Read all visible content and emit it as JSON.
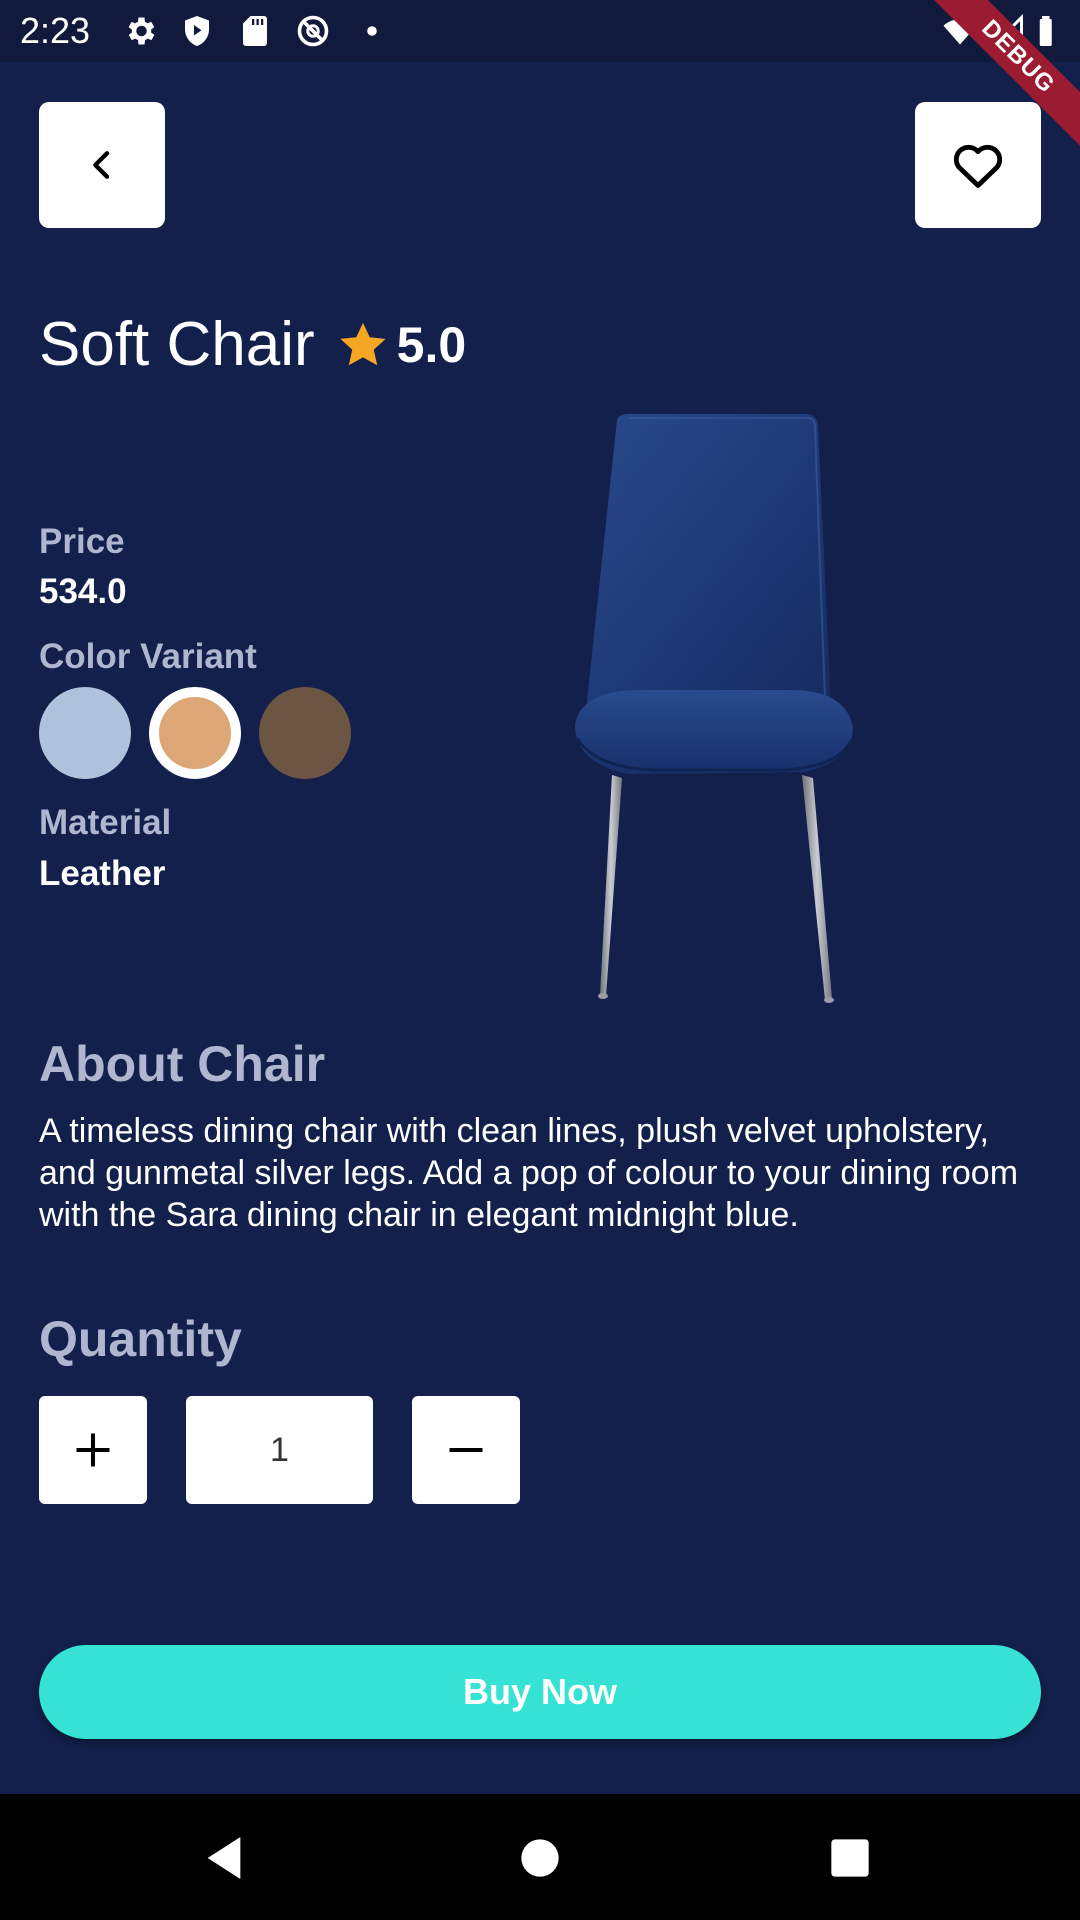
{
  "status_bar": {
    "time": "2:23",
    "left_icons": [
      "gear-icon",
      "play-protect-icon",
      "sd-card-icon",
      "no-disturb-icon",
      "dot-icon"
    ],
    "right_icons": [
      "wifi-icon",
      "signal-icon",
      "battery-icon"
    ],
    "debug_banner": "DEBUG"
  },
  "header": {
    "back_icon": "chevron-left-icon",
    "favorite_icon": "heart-outline-icon"
  },
  "product": {
    "title": "Soft Chair",
    "rating": "5.0",
    "price_label": "Price",
    "price_value": "534.0",
    "color_label": "Color Variant",
    "colors": [
      "#aec2dc",
      "#dca677",
      "#6c5542"
    ],
    "selected_color_index": 1,
    "material_label": "Material",
    "material_value": "Leather",
    "image": "blue-velvet-chair"
  },
  "about": {
    "heading": "About Chair",
    "text": "A timeless dining chair with clean lines, plush velvet upholstery, and gunmetal silver legs. Add a pop of colour to your dining room with the Sara dining chair in elegant midnight blue."
  },
  "quantity": {
    "heading": "Quantity",
    "value": "1"
  },
  "buy": {
    "label": "Buy Now"
  },
  "colors": {
    "background": "#13204c",
    "accent": "#36e2d3",
    "star": "#f5a623"
  }
}
